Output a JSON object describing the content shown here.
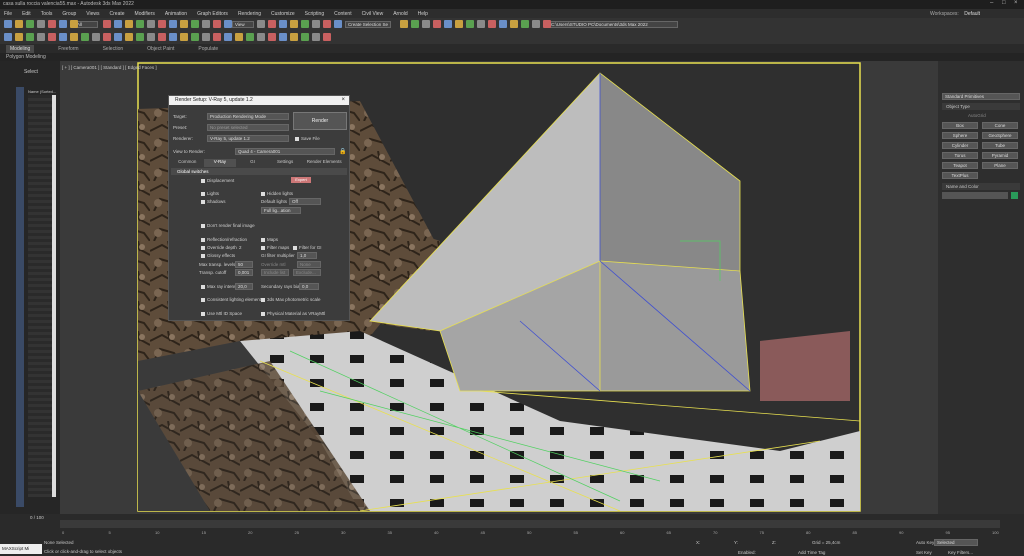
{
  "window": {
    "title": "casa sulla roccia valencia55.max - Autodesk 3ds Max 2022",
    "workspaces_label": "Workspaces:",
    "workspace": "Default"
  },
  "menu": [
    "File",
    "Edit",
    "Tools",
    "Group",
    "Views",
    "Create",
    "Modifiers",
    "Animation",
    "Graph Editors",
    "Rendering",
    "Customize",
    "Scripting",
    "Content",
    "Civil View",
    "Arnold",
    "Help"
  ],
  "toolbar": {
    "selection_filter": "All",
    "view_dropdown": "View",
    "create_selection_set": "Create Selection Se",
    "path": "C:\\Users\\STUDIO PC\\Documents\\3ds Max 2022"
  },
  "ribbon": {
    "tabs": [
      "Modeling",
      "Freeform",
      "Selection",
      "Object Paint",
      "Populate"
    ],
    "sub": "Polygon Modeling"
  },
  "scene": {
    "select_label": "Select",
    "name_header": "Name (Sorted..."
  },
  "viewport": {
    "label": "[ + ] [ Camera001 ] [ Standard ] [ Edged Faces ]"
  },
  "render_setup": {
    "title": "Render Setup: V-Ray 5, update 1.2",
    "target_label": "Target:",
    "target": "Production Rendering Mode",
    "preset_label": "Preset:",
    "preset": "No preset selected",
    "renderer_label": "Renderer:",
    "renderer": "V-Ray 5, update 1.2",
    "save_file": "Save File",
    "render_button": "Render",
    "view_label": "View to Render:",
    "view": "Quad 4 - Camera001",
    "tabs": [
      "Common",
      "V-Ray",
      "GI",
      "Settings",
      "Render Elements"
    ],
    "rollout": "Global switches",
    "displacement": "Displacement",
    "expert": "Expert",
    "lights": "Lights",
    "hidden_lights": "Hidden lights",
    "shadows": "Shadows",
    "default_lights_label": "Default lights",
    "default_lights": "Off",
    "full_lighting": "Full lig...ation",
    "dont_render": "Don't render final image",
    "reflection": "Reflection/refraction",
    "maps": "Maps",
    "override_depth": "Override depth",
    "override_depth_val": "2",
    "filter_maps": "Filter maps",
    "filter_gi": "Filter for GI",
    "glossy": "Glossy effects",
    "gi_filter": "GI filter multiplier",
    "gi_filter_val": "1,0",
    "max_transp": "Max transp. levels",
    "max_transp_val": "50",
    "override_mtl": "Override mtl",
    "none": "None",
    "transp_cutoff": "Transp. cutoff",
    "transp_cutoff_val": "0,001",
    "include_list": "Include list",
    "exclude": "Exclude...",
    "max_ray": "Max ray intens",
    "max_ray_val": "20,0",
    "secondary_bias": "Secondary rays bias",
    "secondary_bias_val": "0,0",
    "consistent": "Consistent lighting elements",
    "photometric": "3ds Max photometric scale",
    "legacy": "Use Mtl ID Space",
    "physical": "Physical Material as VRayMtl"
  },
  "cmd_panel": {
    "standard": "Standard Primitives",
    "object_type": "Object Type",
    "autogrid": "AutoGrid",
    "buttons": [
      "Box",
      "Cone",
      "Sphere",
      "GeoSphere",
      "Cylinder",
      "Tube",
      "Torus",
      "Pyramid",
      "Teapot",
      "Plane",
      "TextPlus"
    ],
    "name_color": "Name and Color"
  },
  "status": {
    "frame": "0 / 100",
    "none_selected": "None Selected",
    "hint": "Click or click-and-drag to select objects",
    "maxscript": "MAXScript Mi",
    "x_label": "X:",
    "y_label": "Y:",
    "z_label": "Z:",
    "grid": "Grid = 25,4cm",
    "add_time_tag": "Add Time Tag",
    "enabled": "Enabled:",
    "auto_key": "Auto Key",
    "selected": "Selected",
    "set_key": "Set Key",
    "key_filters": "Key Filters..."
  },
  "timeline_ticks": [
    "0",
    "5",
    "10",
    "15",
    "20",
    "25",
    "30",
    "35",
    "40",
    "45",
    "50",
    "55",
    "60",
    "65",
    "70",
    "75",
    "80",
    "85",
    "90",
    "95",
    "100"
  ],
  "colors": {
    "accent": "#3a76c8",
    "yellow": "#e8e050",
    "bg": "#2b2b2b"
  }
}
